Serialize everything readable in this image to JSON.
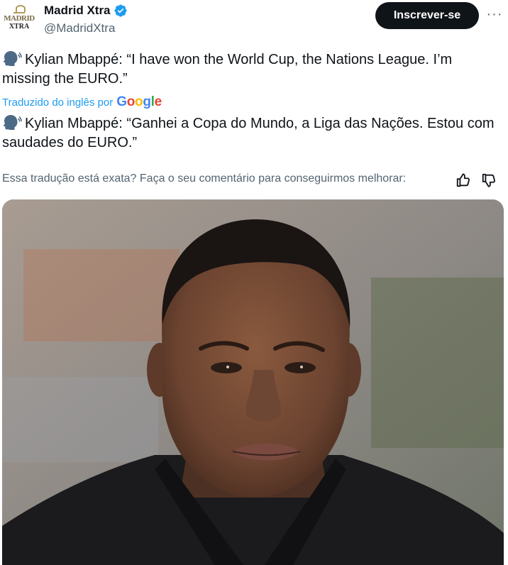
{
  "author": {
    "name": "Madrid Xtra",
    "handle": "@MadridXtra",
    "avatar_line1": "MADRID",
    "avatar_line2": "XTRA",
    "verified_icon": "verified-badge-icon"
  },
  "actions": {
    "subscribe_label": "Inscrever-se",
    "more_label": "···"
  },
  "tweet": {
    "original_text": "Kylian Mbappé: “I have won the World Cup, the Nations League. I’m missing the EURO.”",
    "translated_by_label": "Traduzido do inglês por",
    "translator_brand": "Google",
    "translated_text": "Kylian Mbappé: “Ganhei a Copa do Mundo, a Liga das Nações. Estou com saudades do EURO.”",
    "feedback_prompt": "Essa tradução está exata? Faça o seu comentário para conseguirmos melhorar:"
  },
  "media": {
    "kind": "photo"
  },
  "colors": {
    "link_blue": "#1d9bf0",
    "text_primary": "#0f1419",
    "text_secondary": "#536471",
    "button_dark": "#0f1419"
  }
}
